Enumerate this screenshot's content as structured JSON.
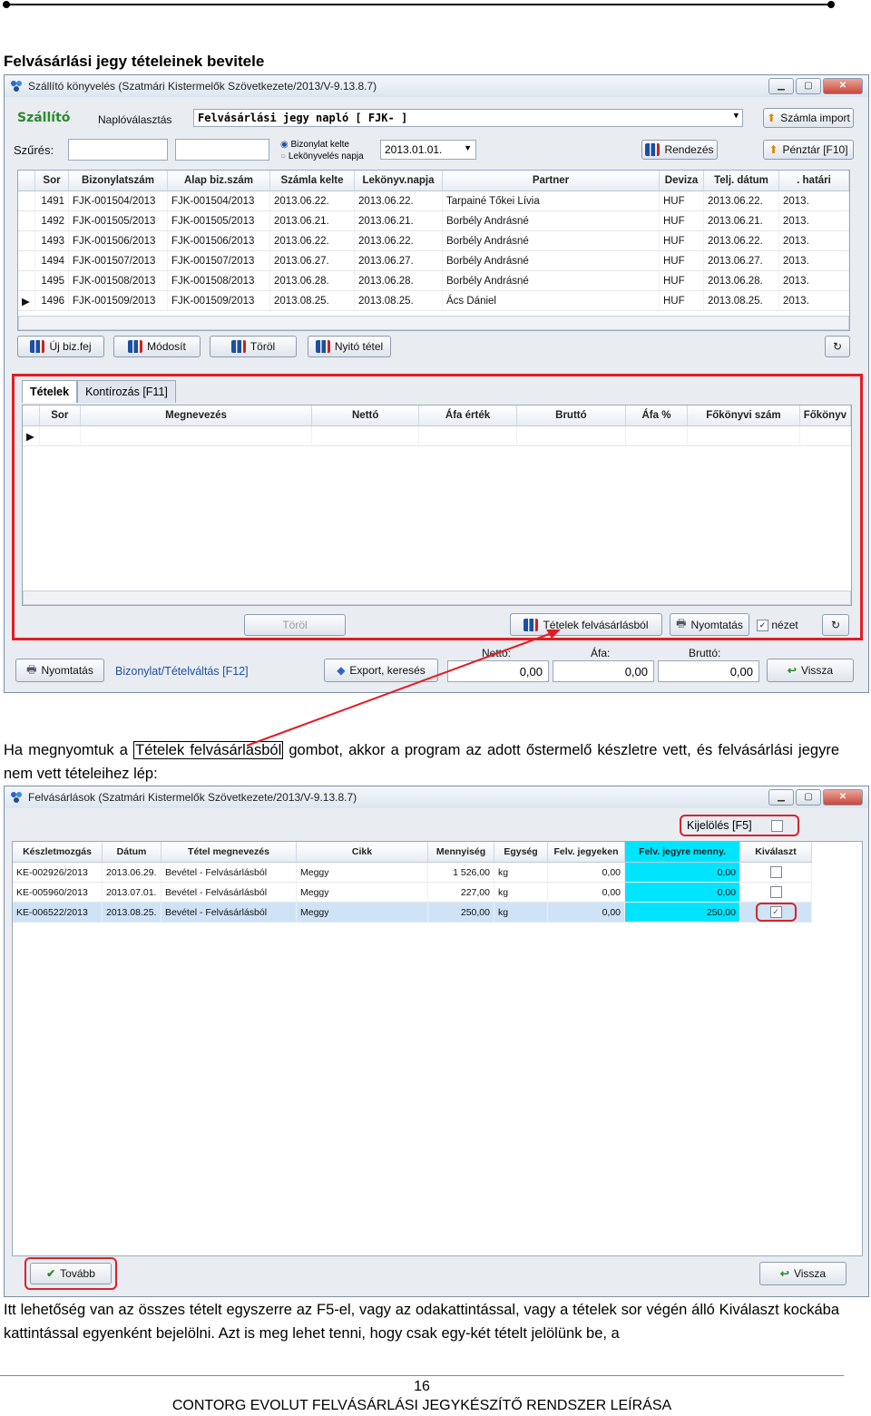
{
  "heading": "Felvásárlási jegy tételeinek bevitele",
  "window1": {
    "title": "Szállító könyvelés (Szatmári Kistermelők Szövetkezete/2013/V-9.13.8.7)",
    "section": "Szállító",
    "naplovalasztas_label": "Naplóválasztás",
    "naplo_value": "Felvásárlási jegy napló [ FJK- ]",
    "szamla_import": "Számla import",
    "szures_label": "Szűrés:",
    "radio1": "Bizonylat kelte",
    "radio2": "Lekönyvelés napja",
    "date_value": "2013.01.01.",
    "rendezes": "Rendezés",
    "penztar": "Pénztár [F10]",
    "columns": [
      "Sor",
      "Bizonylatszám",
      "Alap biz.szám",
      "Számla kelte",
      "Lekönyv.napja",
      "Partner",
      "Deviza",
      "Telj. dátum",
      ". határi"
    ],
    "rows": [
      [
        "1491",
        "FJK-001504/2013",
        "FJK-001504/2013",
        "2013.06.22.",
        "2013.06.22.",
        "Tarpainé Tőkei Lívia",
        "HUF",
        "2013.06.22.",
        "2013."
      ],
      [
        "1492",
        "FJK-001505/2013",
        "FJK-001505/2013",
        "2013.06.21.",
        "2013.06.21.",
        "Borbély Andrásné",
        "HUF",
        "2013.06.21.",
        "2013."
      ],
      [
        "1493",
        "FJK-001506/2013",
        "FJK-001506/2013",
        "2013.06.22.",
        "2013.06.22.",
        "Borbély Andrásné",
        "HUF",
        "2013.06.22.",
        "2013."
      ],
      [
        "1494",
        "FJK-001507/2013",
        "FJK-001507/2013",
        "2013.06.27.",
        "2013.06.27.",
        "Borbély Andrásné",
        "HUF",
        "2013.06.27.",
        "2013."
      ],
      [
        "1495",
        "FJK-001508/2013",
        "FJK-001508/2013",
        "2013.06.28.",
        "2013.06.28.",
        "Borbély Andrásné",
        "HUF",
        "2013.06.28.",
        "2013."
      ],
      [
        "1496",
        "FJK-001509/2013",
        "FJK-001509/2013",
        "2013.08.25.",
        "2013.08.25.",
        "Ács Dániel",
        "HUF",
        "2013.08.25.",
        "2013."
      ]
    ],
    "btn_uj": "Új biz.fej",
    "btn_modosit": "Módosít",
    "btn_torol": "Töröl",
    "btn_nyito": "Nyitó tétel",
    "tab_tetelek": "Tételek",
    "tab_kontirozas": "Kontírozás [F11]",
    "sub_columns": [
      "Sor",
      "Megnevezés",
      "Nettó",
      "Áfa érték",
      "Bruttó",
      "Áfa %",
      "Főkönyvi szám",
      "Főkönyv"
    ],
    "btn_torol2": "Töröl",
    "btn_tetelek": "Tételek felvásárlásból",
    "btn_nyomtatas": "Nyomtatás",
    "nezet": "nézet",
    "footer_nyomtatas": "Nyomtatás",
    "footer_link": "Bizonylat/Tételváltás [F12]",
    "footer_export": "Export, keresés",
    "netto_label": "Nettó:",
    "afa_label": "Áfa:",
    "brutto_label": "Bruttó:",
    "netto_value": "0,00",
    "afa_value": "0,00",
    "brutto_value": "0,00",
    "vissza": "Vissza"
  },
  "para1": {
    "before": "Ha megnyomtuk a ",
    "boxed": "Tételek felvásárlásból",
    "after": " gombot, akkor a program az adott őstermelő készletre vett, és felvásárlási jegyre nem vett tételeihez lép:"
  },
  "window2": {
    "title": "Felvásárlások (Szatmári Kistermelők Szövetkezete/2013/V-9.13.8.7)",
    "kijeloles": "Kijelölés [F5]",
    "columns": [
      "Készletmozgás",
      "Dátum",
      "Tétel megnevezés",
      "Cikk",
      "Mennyiség",
      "Egység",
      "Felv. jegyeken",
      "Felv. jegyre menny.",
      "Kiválaszt"
    ],
    "rows": [
      [
        "KE-002926/2013",
        "2013.06.29.",
        "Bevétel - Felvásárlásból",
        "Meggy",
        "1 526,00",
        "kg",
        "0,00",
        "0,00",
        false
      ],
      [
        "KE-005960/2013",
        "2013.07.01.",
        "Bevétel - Felvásárlásból",
        "Meggy",
        "227,00",
        "kg",
        "0,00",
        "0,00",
        false
      ],
      [
        "KE-006522/2013",
        "2013.08.25.",
        "Bevétel - Felvásárlásból",
        "Meggy",
        "250,00",
        "kg",
        "0,00",
        "250,00",
        true
      ]
    ],
    "tovabb": "Tovább",
    "vissza": "Vissza"
  },
  "para2": "Itt lehetőség van az összes tételt egyszerre az F5-el, vagy az odakattintással, vagy a tételek sor végén álló Kiválaszt kockába kattintással egyenként bejelölni. Azt is meg lehet tenni, hogy csak egy-két tételt jelölünk be, a",
  "page_number": "16",
  "footer": "CONTORG EVOLUT FELVÁSÁRLÁSI JEGYKÉSZÍTŐ RENDSZER LEÍRÁSA",
  "colors": {
    "annotation_red": "#e31c23",
    "highlight_cyan": "#00e5ff",
    "section_green": "#2c8a2c"
  }
}
